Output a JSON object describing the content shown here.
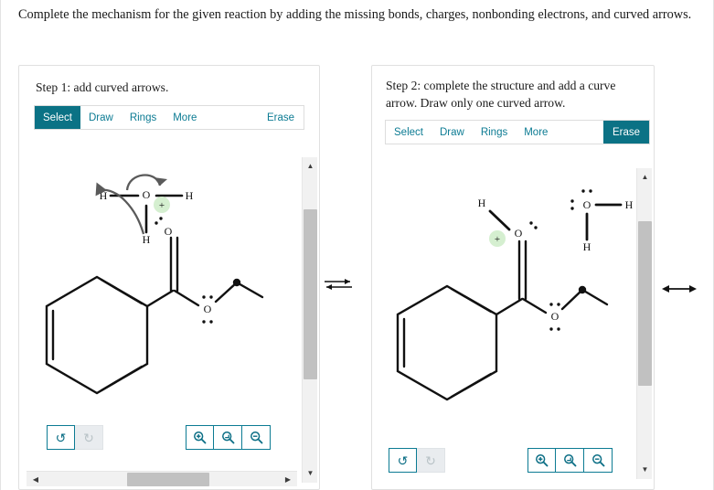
{
  "question": "Complete the mechanism for the given reaction by adding the missing bonds, charges, nonbonding electrons, and curved arrows.",
  "panels": {
    "left": {
      "step_title": "Step 1: add curved arrows.",
      "toolbar": {
        "items": [
          {
            "label": "Select",
            "active": true
          },
          {
            "label": "Draw",
            "active": false
          },
          {
            "label": "Rings",
            "active": false
          },
          {
            "label": "More",
            "active": false
          }
        ],
        "erase_label": "Erase",
        "erase_active": false
      },
      "controls": {
        "undo_label": "undo-icon",
        "redo_label": "redo-icon",
        "redo_disabled": true,
        "zoom_in_label": "zoom-in-icon",
        "zoom_reset_label": "zoom-reset-icon",
        "zoom_out_label": "zoom-out-icon"
      },
      "structure": {
        "atoms": {
          "carbonyl_o": "O",
          "ester_o": "O",
          "hydronium_o": "O",
          "h_left": "H",
          "h_right": "H",
          "h_bottom": "H",
          "charge": "+"
        }
      }
    },
    "right": {
      "step_title": "Step 2: complete the structure and add a curve arrow. Draw only one curved arrow.",
      "toolbar": {
        "items": [
          {
            "label": "Select",
            "active": false
          },
          {
            "label": "Draw",
            "active": false
          },
          {
            "label": "Rings",
            "active": false
          },
          {
            "label": "More",
            "active": false
          }
        ],
        "erase_label": "Erase",
        "erase_active": true
      },
      "controls": {
        "undo_label": "undo-icon",
        "redo_label": "redo-icon",
        "redo_disabled": true,
        "zoom_in_label": "zoom-in-icon",
        "zoom_reset_label": "zoom-reset-icon",
        "zoom_out_label": "zoom-out-icon"
      },
      "structure": {
        "atoms": {
          "carbonyl_o": "O",
          "ester_o": "O",
          "water_o": "O",
          "h_top": "H",
          "h_water_right": "H",
          "h_water_bottom": "H",
          "charge": "+"
        }
      }
    }
  },
  "colors": {
    "accent": "#0b7285",
    "accent_text": "#0c7b93",
    "charge_highlight": "#d5efd0",
    "arrow_gray": "#5a5a5a",
    "bond_black": "#111111"
  },
  "symbols": {
    "equilibrium_arrow": "equilibrium-arrow",
    "double_headed_arrow": "double-headed-arrow"
  }
}
